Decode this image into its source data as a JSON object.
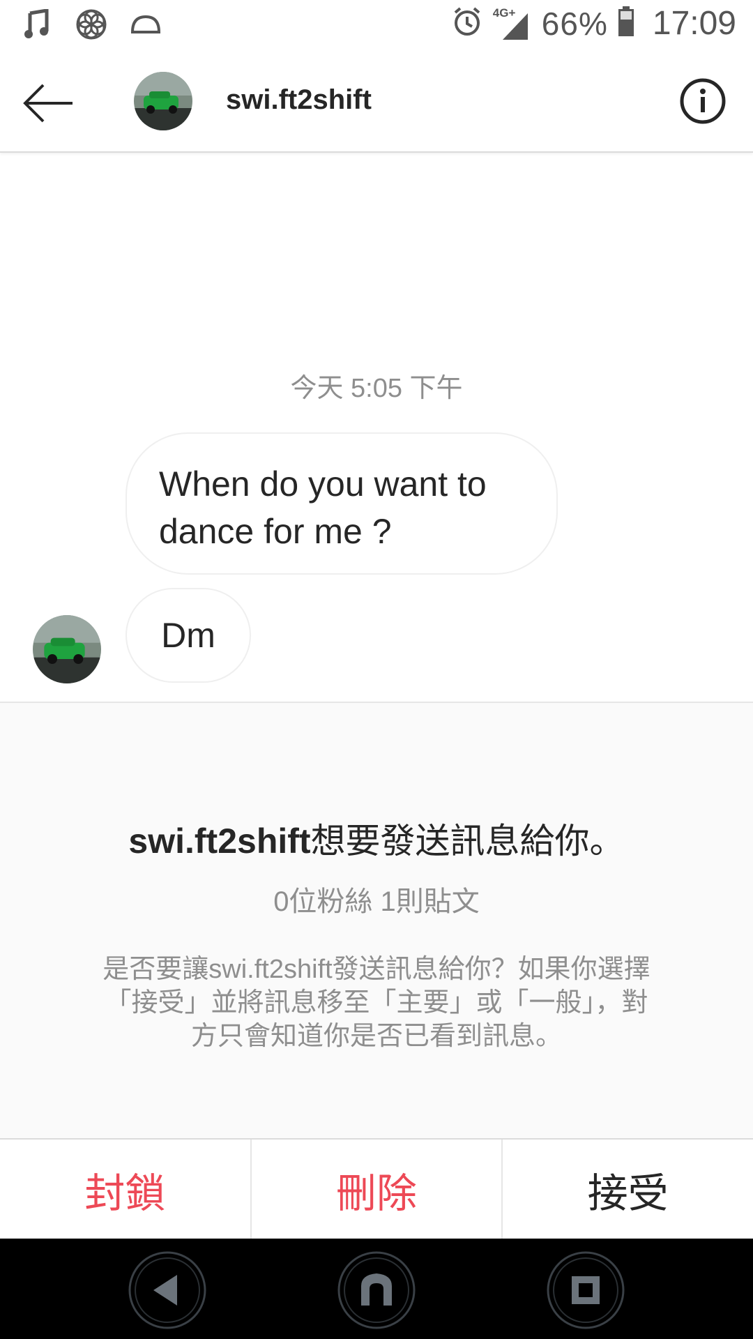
{
  "status_bar": {
    "icons_left": [
      "music-note-icon",
      "flower-icon",
      "dome-icon"
    ],
    "icons_right": [
      "alarm-icon",
      "signal-4g-icon",
      "battery-icon"
    ],
    "network": "4G+",
    "battery": "66%",
    "time": "17:09"
  },
  "header": {
    "username": "swi.ft2shift",
    "back_icon": "arrow-left-icon",
    "info_icon": "info-icon"
  },
  "conversation": {
    "timestamp": "今天 5:05 下午",
    "messages": [
      {
        "text": "When do you want to dance for me ?"
      },
      {
        "text": "Dm"
      }
    ]
  },
  "request": {
    "title_user": "swi.ft2shift",
    "title_suffix": "想要發送訊息給你。",
    "stats": "0位粉絲 1則貼文",
    "description": "是否要讓swi.ft2shift發送訊息給你？如果你選擇「接受」並將訊息移至「主要」或「一般」，對方只會知道你是否已看到訊息。"
  },
  "actions": {
    "block": "封鎖",
    "delete": "刪除",
    "accept": "接受"
  },
  "colors": {
    "danger": "#ed4956",
    "text": "#262626",
    "secondary": "#8e8e8e"
  },
  "nav_bar": {
    "icons": [
      "back-triangle-icon",
      "home-icon",
      "recents-square-icon"
    ]
  }
}
